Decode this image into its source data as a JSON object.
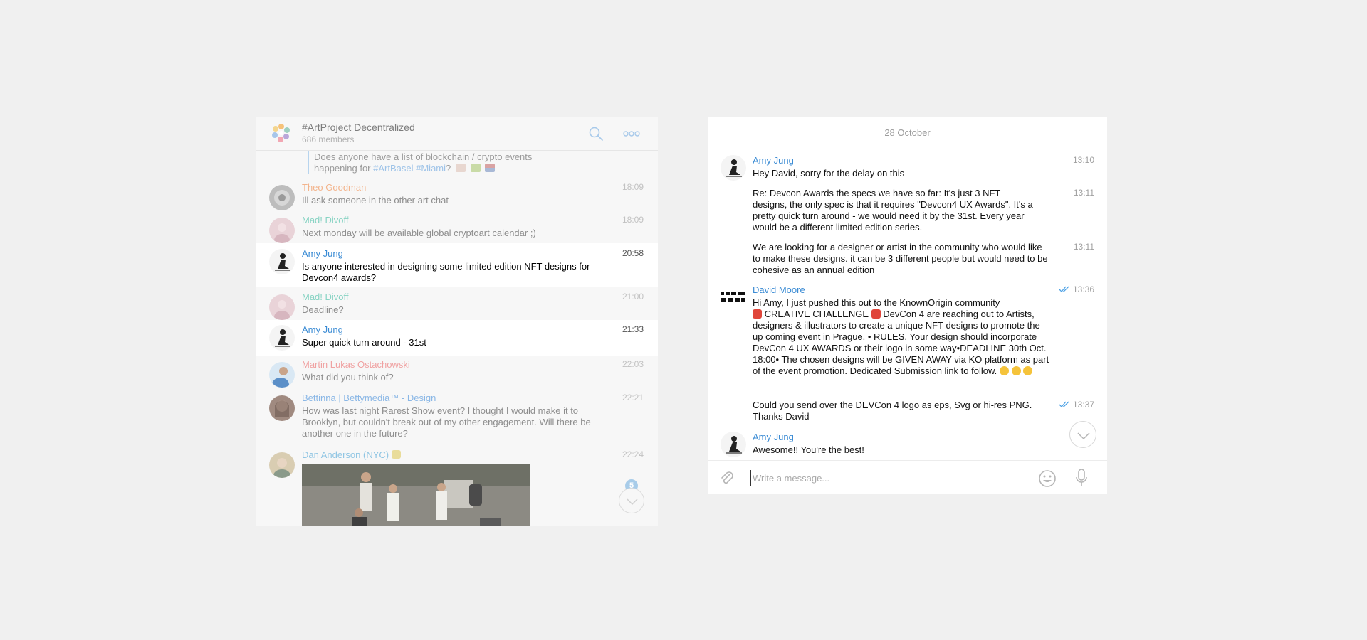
{
  "left": {
    "header": {
      "title": "#ArtProject Decentralized",
      "members": "686 members"
    },
    "quote": {
      "line1": "Does anyone have a list of blockchain / crypto events",
      "line2_prefix": "happening for ",
      "tag1": "#ArtBasel",
      "tag2": "#Miami",
      "line2_suffix": "?"
    },
    "messages": [
      {
        "name": "Theo Goodman",
        "text": "Ill ask someone in the other art chat",
        "time": "18:09"
      },
      {
        "name": "Mad! Divoff",
        "text": "Next monday will be available global cryptoart calendar ;)",
        "time": "18:09"
      },
      {
        "name": "Amy Jung",
        "text": "Is anyone interested in designing some limited edition NFT designs for Devcon4 awards?",
        "time": "20:58"
      },
      {
        "name": "Mad! Divoff",
        "text": "Deadline?",
        "time": "21:00"
      },
      {
        "name": "Amy Jung",
        "text": "Super quick turn around - 31st",
        "time": "21:33"
      },
      {
        "name": "Martin Lukas Ostachowski",
        "text": "What did you think of?",
        "time": "22:03"
      },
      {
        "name": "Bettinna | Bettymedia™ - Design",
        "text": "How was last night Rarest Show event? I thought I would make it to Brooklyn, but couldn't break out of my other engagement. Will there be another one in the future?",
        "time": "22:21"
      },
      {
        "name": "Dan Anderson (NYC)",
        "text": "",
        "time": "22:24"
      }
    ],
    "unread_badge": "5",
    "colors": {
      "theo": "#f3b48c",
      "divoff": "#87d3c3",
      "amy": "#3a8bd4",
      "martin": "#f0a2a2",
      "bettinna": "#8ab7e6",
      "dan": "#8fc5e3"
    }
  },
  "right": {
    "date": "28 October",
    "messages": [
      {
        "name": "Amy Jung",
        "text": "Hey David, sorry for the delay on this",
        "time": "13:10"
      },
      {
        "text": "Re: Devcon Awards the specs we have so far: It's just 3 NFT designs, the only spec is that it requires \"Devcon4 UX Awards\". It's a pretty quick turn around - we would need it by the 31st. Every year would be a different limited edition series.",
        "time": "13:11"
      },
      {
        "text": "We are looking for a designer or artist in the community who would like to make these designs. it can be 3 different people but would need to be cohesive as an annual edition",
        "time": "13:11"
      },
      {
        "name": "David Moore",
        "line1": "Hi Amy, I just pushed this out to the KnownOrigin community",
        "line2a": " CREATIVE CHALLENGE ",
        "line2b": " DevCon 4 are reaching out to Artists, designers & illustrators to create a unique NFT designs to promote the up coming event in Prague. • RULES, Your design should incorporate DevCon 4 UX AWARDS or their logo in some way•DEADLINE 30th Oct. 18:00• The chosen designs will be GIVEN AWAY via KO platform as part of the event promotion. Dedicated Submission link to follow.",
        "time": "13:36"
      },
      {
        "text": "Could you send over the DEVCon 4 logo as eps, Svg or hi-res PNG. Thanks David",
        "time": "13:37"
      },
      {
        "name": "Amy Jung",
        "text": "Awesome!! You're the best!"
      }
    ],
    "composer": {
      "placeholder": "Write a message..."
    }
  }
}
